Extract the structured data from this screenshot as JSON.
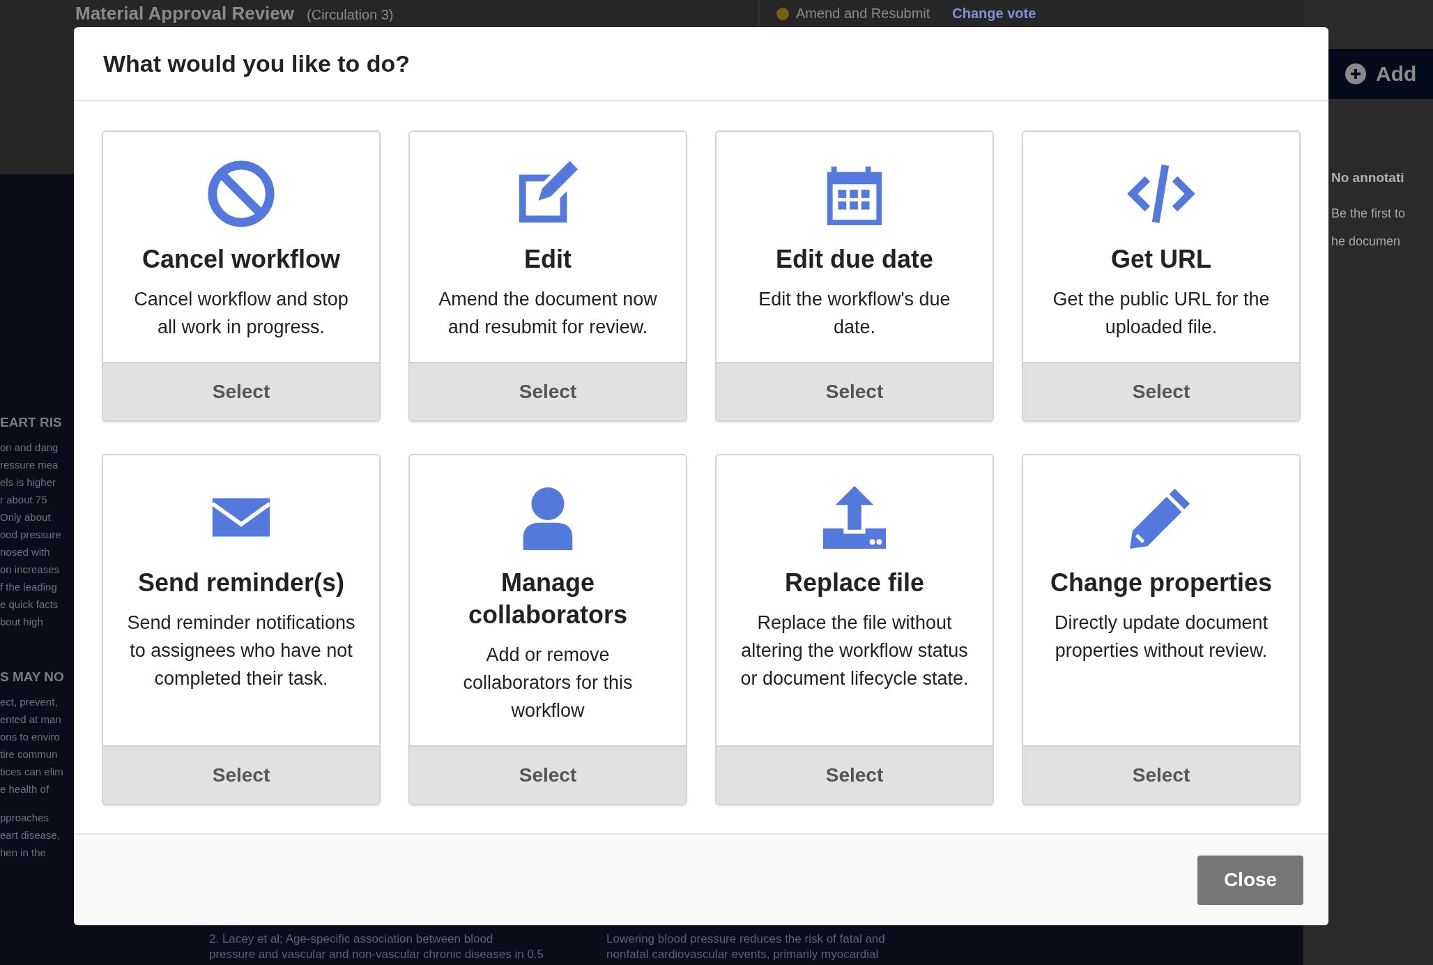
{
  "background": {
    "title": "Material Approval Review",
    "circulation": "(Circulation 3)",
    "vote": {
      "label": "Amend and Resubmit",
      "action": "Change vote"
    },
    "side_panel": {
      "add_button": "Add",
      "empty_title": "No annotati",
      "empty_text": [
        "Be the first to",
        "he documen"
      ]
    },
    "poster": {
      "sections": [
        {
          "heading": "EART RIS",
          "paragraphs": [
            [
              "on and dang",
              "ressure mea",
              "els is higher",
              "r about 75",
              "Only about",
              "ood pressure",
              "nosed with",
              "on increases",
              "f the leading",
              "e quick facts",
              "bout high"
            ]
          ]
        },
        {
          "heading": "S MAY NO",
          "paragraphs": [
            [
              "ect, prevent,",
              "ented at man",
              "ons to enviro",
              "tire commun",
              "tices can elim",
              "e health of"
            ],
            [
              "pproaches",
              "eart disease,",
              "hen in the"
            ]
          ]
        }
      ],
      "footnotes": [
        [
          "2. Lacey et al; Age-specific association between blood",
          "pressure and vascular and non-vascular chronic diseases in 0.5"
        ],
        [
          "Lowering blood pressure reduces the risk of fatal and",
          "nonfatal cardiovascular events, primarily myocardial"
        ]
      ]
    }
  },
  "dialog": {
    "title": "What would you like to do?",
    "options": [
      {
        "kind": "ban",
        "title": "Cancel workflow",
        "description": "Cancel workflow and stop all work in progress.",
        "action": "Select"
      },
      {
        "kind": "edit",
        "title": "Edit",
        "description": "Amend the document now and resubmit for review.",
        "action": "Select"
      },
      {
        "kind": "calendar",
        "title": "Edit due date",
        "description": "Edit the workflow's due date.",
        "action": "Select"
      },
      {
        "kind": "code",
        "title": "Get URL",
        "description": "Get the public URL for the uploaded file.",
        "action": "Select"
      },
      {
        "kind": "envelope",
        "title": "Send reminder(s)",
        "description": "Send reminder notifications to assignees who have not completed their task.",
        "action": "Select"
      },
      {
        "kind": "user",
        "title": "Manage collaborators",
        "description": "Add or remove collaborators for this workflow",
        "action": "Select"
      },
      {
        "kind": "upload",
        "title": "Replace file",
        "description": "Replace the file without altering the workflow status or document lifecycle state.",
        "action": "Select"
      },
      {
        "kind": "pencil",
        "title": "Change properties",
        "description": "Directly update document properties without review.",
        "action": "Select"
      }
    ],
    "close_button": "Close"
  }
}
